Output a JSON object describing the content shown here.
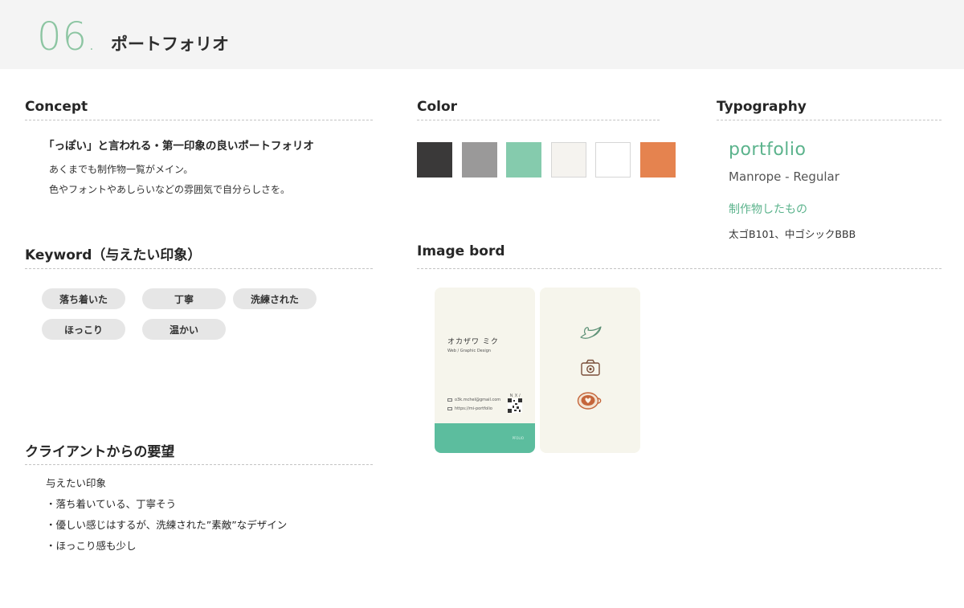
{
  "header": {
    "number": "06",
    "dot": ".",
    "title": "ポートフォリオ"
  },
  "concept": {
    "title": "Concept",
    "lead": "「っぽい」と言われる・第一印象の良いポートフォリオ",
    "lines": [
      "あくまでも制作物一覧がメイン。",
      "色やフォントやあしらいなどの雰囲気で自分らしさを。"
    ]
  },
  "color": {
    "title": "Color",
    "swatches": [
      "#3a3939",
      "#9a9999",
      "#85cbad",
      "#f5f3ef",
      "#ffffff",
      "#e5834f"
    ]
  },
  "typography": {
    "title": "Typography",
    "sample": "portfolio",
    "font": "Manrope - Regular",
    "jp_sample": "制作物したもの",
    "jp_font": "太ゴB101、中ゴシックBBB"
  },
  "keyword": {
    "title": "Keyword（与えたい印象）",
    "pills": [
      "落ち着いた",
      "丁寧",
      "洗練された",
      "ほっこり",
      "温かい"
    ]
  },
  "imageboard": {
    "title": "Image bord",
    "card_front": {
      "name": "オカザワ ミク",
      "role": "Web / Graphic Design",
      "email": "o3k.mchel@gmail.com",
      "url": "https://mi-portfolio",
      "qr_mark": "ＮＸ/",
      "band_text": "PFOLIO"
    },
    "icons": [
      "bird-icon",
      "camera-icon",
      "latte-icon"
    ]
  },
  "request": {
    "title": "クライアントからの要望",
    "subtitle": "与えたい印象",
    "lines": [
      "・落ち着いている、丁寧そう",
      "・優しい感じはするが、洗練された”素敵”なデザイン",
      "・ほっこり感も少し"
    ]
  }
}
